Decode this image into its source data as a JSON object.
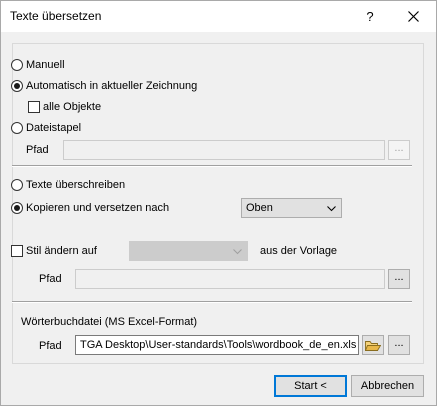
{
  "window": {
    "title": "Texte übersetzen",
    "help_glyph": "?"
  },
  "options": {
    "manuell": "Manuell",
    "auto": "Automatisch in aktueller Zeichnung",
    "alle_objekte": "alle Objekte",
    "dateistapel": "Dateistapel",
    "pfad_label": "Pfad",
    "browse_glyph": "..."
  },
  "mode": {
    "overwrite": "Texte überschreiben",
    "copy_offset": "Kopieren und versetzen nach",
    "position_value": "Oben"
  },
  "style": {
    "change_label": "Stil ändern auf",
    "from_template": "aus der Vorlage",
    "pfad_label": "Pfad",
    "browse_glyph": "..."
  },
  "dictionary": {
    "section_label": "Wörterbuchdatei (MS Excel-Format)",
    "pfad_label": "Pfad",
    "path_value": "TGA Desktop\\User-standards\\Tools\\wordbook_de_en.xls",
    "browse_glyph": "..."
  },
  "footer": {
    "start_label": "Start <",
    "cancel_label": "Abbrechen"
  },
  "state": {
    "selected_source": "auto",
    "alle_objekte_checked": false,
    "selected_mode": "copy_offset",
    "change_style_checked": false
  },
  "icons": {
    "close": "close-icon",
    "folder": "folder-open-icon",
    "dropdown": "chevron-down-icon"
  },
  "colors": {
    "dialog_bg": "#f0f0f0",
    "titlebar_bg": "#ffffff",
    "focus_border": "#0078d7",
    "folder_icon": "#e8b84a"
  }
}
